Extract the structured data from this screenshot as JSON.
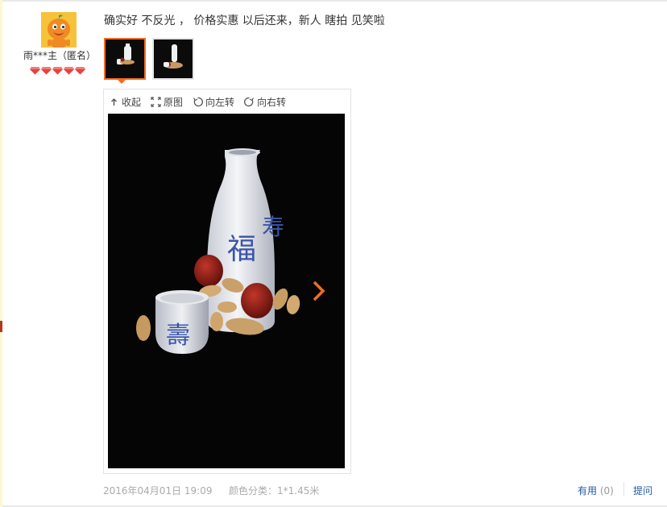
{
  "user": {
    "name": "雨***主（匿名）",
    "avatar_icon": "cartoon-mascot-avatar",
    "badge_icon": "diamond-level-icon",
    "badge_count": 5
  },
  "review": {
    "text": "确实好 不反光 ， 价格实惠 以后还来，新人 瞎拍 见笑啦"
  },
  "viewer": {
    "toolbar": {
      "collapse": "收起",
      "original": "原图",
      "rotate_left": "向左转",
      "rotate_right": "向右转"
    },
    "photo_subject": "sake-bottle-cup-peanuts-dates-photo"
  },
  "meta": {
    "date": "2016年04月01日 19:09",
    "sku_label": "颜色分类：",
    "sku_value": "1*1.45米"
  },
  "actions": {
    "useful_label": "有用",
    "useful_count": "(0)",
    "ask_label": "提问"
  },
  "colors": {
    "accent": "#f26c22",
    "link": "#1f5aa6",
    "muted": "#aaaaaa",
    "badge": "#e8413e"
  }
}
